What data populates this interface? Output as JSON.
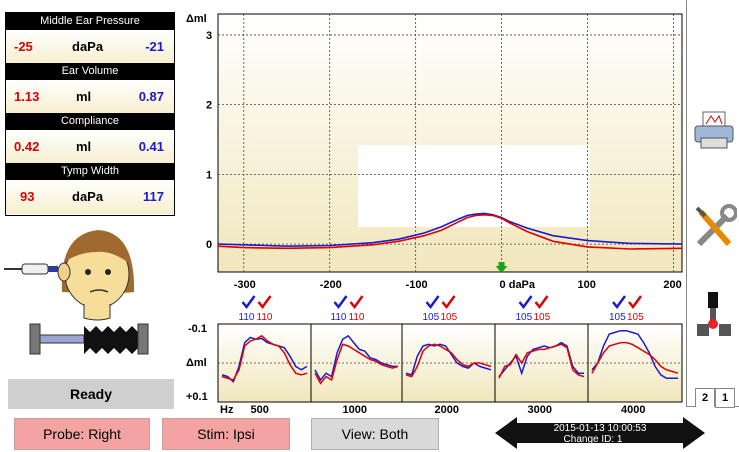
{
  "measurements": {
    "middle_ear_pressure": {
      "label": "Middle Ear Pressure",
      "left": "-25",
      "unit": "daPa",
      "right": "-21"
    },
    "ear_volume": {
      "label": "Ear Volume",
      "left": "1.13",
      "unit": "ml",
      "right": "0.87"
    },
    "compliance": {
      "label": "Compliance",
      "left": "0.42",
      "unit": "ml",
      "right": "0.41"
    },
    "tymp_width": {
      "label": "Tymp Width",
      "left": "93",
      "unit": "daPa",
      "right": "117"
    }
  },
  "status": {
    "ready": "Ready"
  },
  "buttons": {
    "probe": "Probe: Right",
    "stim": "Stim: Ipsi",
    "view": "View: Both"
  },
  "session": {
    "datetime": "2015-01-13  10:00:53",
    "change_id": "Change ID:   1"
  },
  "tabs": {
    "tab2": "2",
    "tab1": "1"
  },
  "icons": {
    "printer": "printer-icon",
    "tools": "tools-icon",
    "probe": "probe-tool-icon",
    "patient": "patient-head-icon",
    "probe_insert": "ear-probe-icon",
    "bellows": "pressure-pump-icon"
  },
  "colors": {
    "left_ear": "#e00000",
    "right_ear": "#1a1ad0",
    "plot_bg": "#f4ecc4",
    "button_red": "#f4a3a3"
  },
  "chart_data": [
    {
      "type": "line",
      "ylabel": "Δml",
      "xunit": "0 daPa",
      "xticks": [
        -300,
        -200,
        -100,
        0,
        100,
        200
      ],
      "yticks": [
        0,
        1,
        2,
        3
      ],
      "xlim": [
        -330,
        210
      ],
      "ylim": [
        -0.4,
        3.3
      ],
      "peak_marker_x": 0,
      "series": [
        {
          "color": "#1a1ad0",
          "x": [
            -330,
            -300,
            -250,
            -200,
            -150,
            -120,
            -90,
            -70,
            -50,
            -40,
            -30,
            -20,
            -10,
            0,
            10,
            30,
            60,
            100,
            150,
            210
          ],
          "y": [
            0.0,
            -0.01,
            -0.03,
            -0.02,
            0.02,
            0.07,
            0.16,
            0.25,
            0.36,
            0.41,
            0.43,
            0.44,
            0.42,
            0.38,
            0.32,
            0.23,
            0.12,
            0.05,
            0.01,
            0.0
          ]
        },
        {
          "color": "#e00000",
          "x": [
            -330,
            -300,
            -250,
            -200,
            -150,
            -120,
            -90,
            -70,
            -50,
            -40,
            -30,
            -20,
            -10,
            0,
            10,
            30,
            60,
            100,
            150,
            210
          ],
          "y": [
            -0.03,
            -0.05,
            -0.06,
            -0.05,
            -0.01,
            0.04,
            0.12,
            0.2,
            0.32,
            0.38,
            0.41,
            0.42,
            0.41,
            0.37,
            0.3,
            0.18,
            0.04,
            -0.04,
            -0.07,
            -0.06
          ]
        }
      ]
    },
    {
      "type": "line",
      "ylabel": "Δml",
      "yticks_text": [
        "-0.1",
        "+0.1"
      ],
      "xunit": "Hz",
      "xticks": [
        500,
        1000,
        2000,
        3000,
        4000
      ],
      "stim_levels": [
        {
          "freq": 500,
          "right": "110",
          "left": "110"
        },
        {
          "freq": 1000,
          "right": "110",
          "left": "110"
        },
        {
          "freq": 2000,
          "right": "105",
          "left": "105"
        },
        {
          "freq": 3000,
          "right": "105",
          "left": "105"
        },
        {
          "freq": 4000,
          "right": "105",
          "left": "105"
        }
      ],
      "segments": [
        {
          "freq": 500,
          "blue": [
            0.35,
            0.4,
            0.55,
            0.1,
            -0.6,
            -0.75,
            -0.7,
            -0.72,
            -0.6,
            -0.55,
            -0.5,
            -0.45,
            -0.2,
            0.1,
            0.2,
            0.1
          ],
          "red": [
            0.4,
            0.45,
            0.5,
            0.2,
            -0.5,
            -0.65,
            -0.7,
            -0.8,
            -0.65,
            -0.55,
            -0.5,
            -0.3,
            0.05,
            0.3,
            0.35,
            0.3
          ]
        },
        {
          "freq": 1000,
          "blue": [
            0.2,
            0.5,
            0.3,
            0.4,
            -0.3,
            -0.7,
            -0.8,
            -0.6,
            -0.4,
            -0.35,
            -0.15,
            -0.1,
            0.0,
            0.05,
            0.1,
            0.1
          ],
          "red": [
            0.3,
            0.6,
            0.4,
            0.5,
            -0.1,
            -0.55,
            -0.5,
            -0.4,
            -0.3,
            -0.2,
            -0.1,
            -0.05,
            0.05,
            0.1,
            0.15,
            0.1
          ]
        },
        {
          "freq": 2000,
          "blue": [
            0.3,
            0.35,
            -0.2,
            -0.5,
            -0.55,
            -0.5,
            -0.55,
            -0.5,
            -0.25,
            0.0,
            0.1,
            0.15,
            0.0,
            0.1,
            0.15,
            0.2
          ],
          "red": [
            0.35,
            0.4,
            0.1,
            -0.35,
            -0.5,
            -0.55,
            -0.5,
            -0.4,
            -0.3,
            -0.1,
            0.05,
            0.1,
            0.0,
            0.0,
            0.05,
            0.1
          ]
        },
        {
          "freq": 3000,
          "blue": [
            0.4,
            0.2,
            0.0,
            -0.2,
            0.3,
            -0.2,
            -0.4,
            -0.45,
            -0.5,
            -0.45,
            -0.5,
            -0.6,
            -0.5,
            0.1,
            0.3,
            0.3
          ],
          "red": [
            0.45,
            0.1,
            0.05,
            -0.25,
            0.0,
            -0.3,
            -0.35,
            -0.4,
            -0.4,
            -0.45,
            -0.5,
            -0.55,
            -0.45,
            0.2,
            0.35,
            0.4
          ]
        },
        {
          "freq": 4000,
          "blue": [
            0.2,
            0.0,
            -0.5,
            -0.85,
            -0.9,
            -0.95,
            -0.95,
            -0.9,
            -0.85,
            -0.6,
            -0.3,
            0.1,
            0.35,
            0.45,
            0.45,
            0.45
          ],
          "red": [
            0.3,
            0.0,
            -0.3,
            -0.5,
            -0.55,
            -0.6,
            -0.6,
            -0.55,
            -0.45,
            -0.35,
            -0.25,
            -0.1,
            0.1,
            0.2,
            0.25,
            0.3
          ]
        }
      ]
    }
  ]
}
